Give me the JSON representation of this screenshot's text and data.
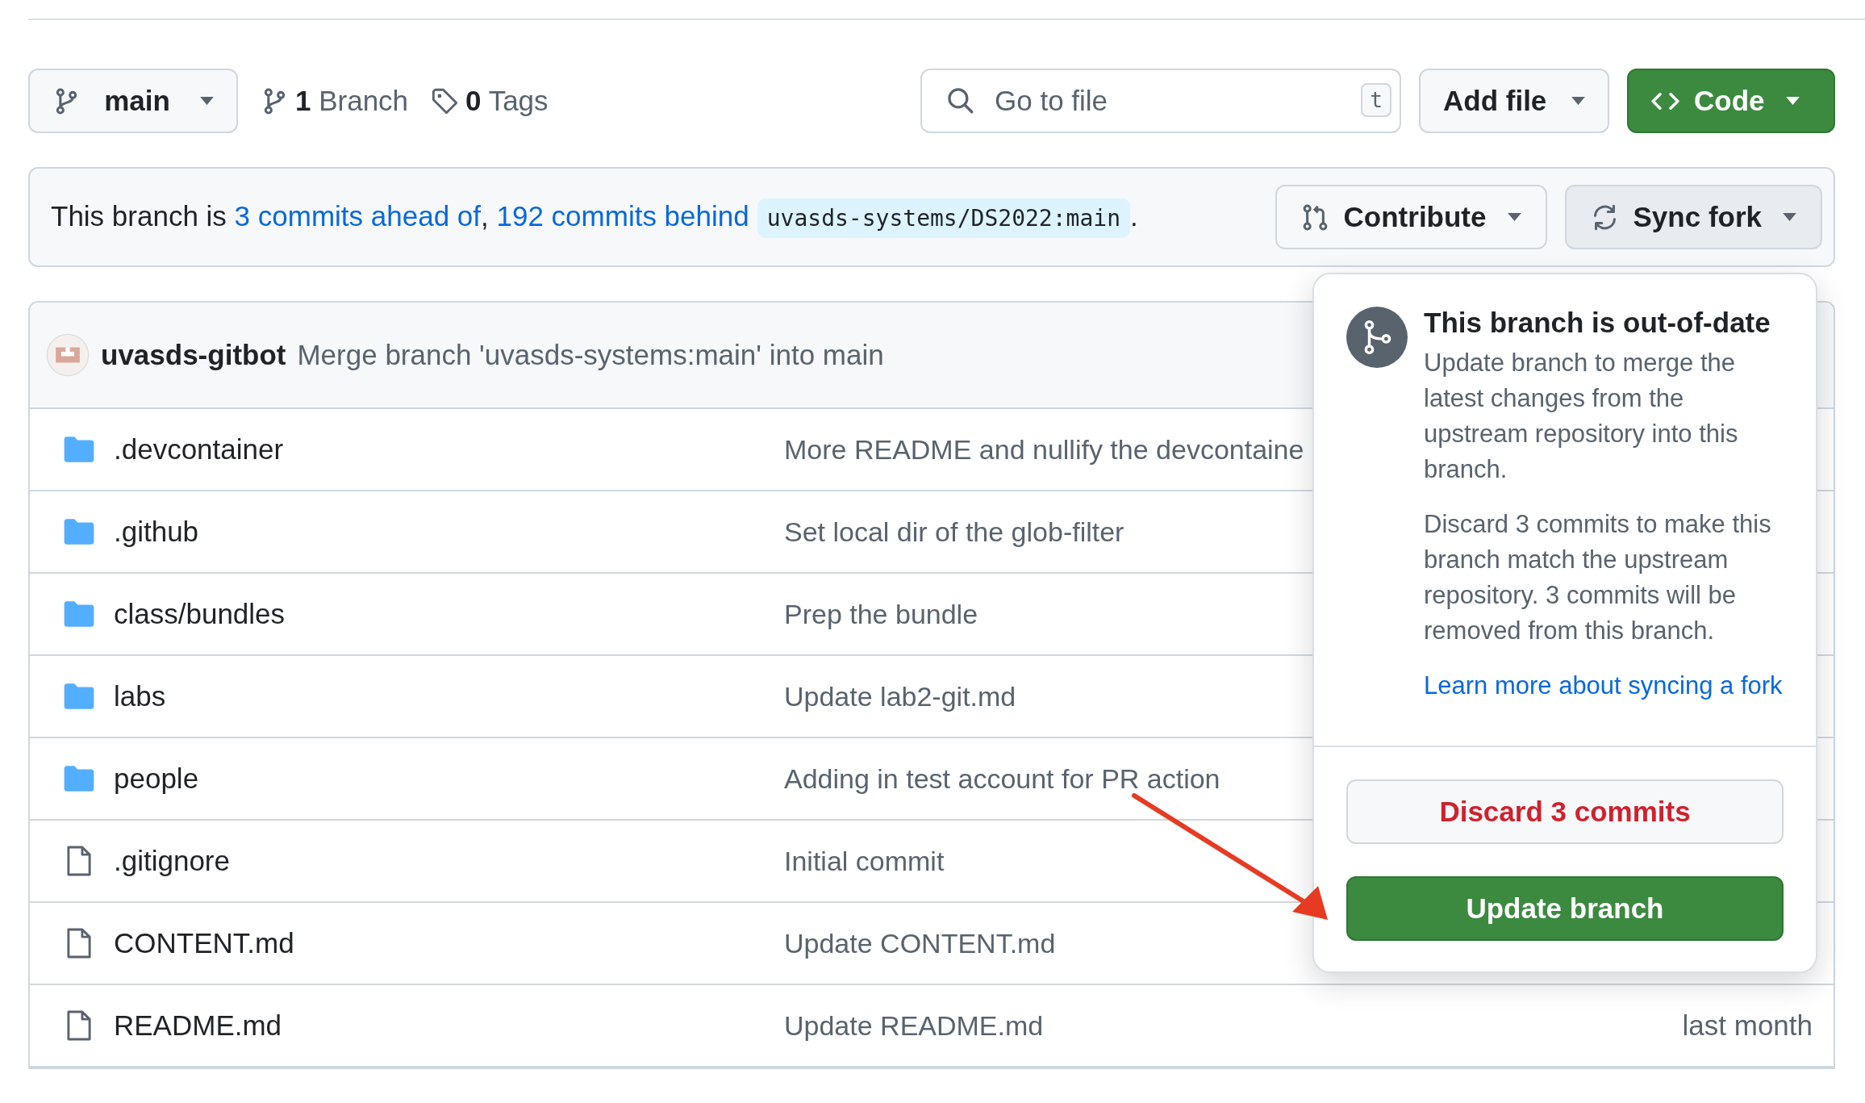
{
  "branch_selector": {
    "label": "main"
  },
  "branches": {
    "text": "**1** Branch"
  },
  "tags": {
    "text": "**0** Tags"
  },
  "search": {
    "placeholder": "Go to file",
    "shortcut": "t"
  },
  "buttons": [
    {
      "label": "Add file",
      "kind": "secondary"
    },
    {
      "label": "Code",
      "kind": "primary"
    }
  ],
  "banner": {
    "parts": [
      {
        "kind": "text",
        "text": "This branch is "
      },
      {
        "kind": "link",
        "text": "3 commits ahead of"
      },
      {
        "kind": "text",
        "text": ", "
      },
      {
        "kind": "link",
        "text": "192 commits behind"
      },
      {
        "kind": "code",
        "text": "uvasds-systems/DS2022:main"
      },
      {
        "kind": "text",
        "text": "."
      }
    ],
    "actions": [
      {
        "label": "Contribute",
        "kind": "contribute",
        "expanded": false
      },
      {
        "label": "Sync fork",
        "kind": "sync",
        "expanded": true
      }
    ]
  },
  "latest_commit": {
    "author": "uvasds-gitbot",
    "message": "Merge branch 'uvasds-systems:main' into main"
  },
  "files": [
    {
      "kind": "folder",
      "name": ".devcontainer",
      "message": "More README and nullify the devcontaine"
    },
    {
      "kind": "folder",
      "name": ".github",
      "message": "Set local dir of the glob-filter"
    },
    {
      "kind": "folder",
      "name": "class/bundles",
      "message": "Prep the bundle"
    },
    {
      "kind": "folder",
      "name": "labs",
      "message": "Update lab2-git.md"
    },
    {
      "kind": "folder",
      "name": "people",
      "message": "Adding in test account for PR action"
    },
    {
      "kind": "file",
      "name": ".gitignore",
      "message": "Initial commit"
    },
    {
      "kind": "file",
      "name": "CONTENT.md",
      "message": "Update CONTENT.md"
    },
    {
      "kind": "file",
      "name": "README.md",
      "message": "Update README.md",
      "date": "last month"
    }
  ],
  "popover": {
    "title": "This branch is out-of-date",
    "paragraphs": [
      "Update branch to merge the latest changes from the upstream repository into this branch.",
      "Discard 3 commits to make this branch match the upstream repository. 3 commits will be removed from this branch."
    ],
    "link": "Learn more about syncing a fork",
    "buttons": [
      {
        "label": "Discard 3 commits",
        "kind": "danger"
      },
      {
        "label": "Update branch",
        "kind": "primary"
      }
    ]
  }
}
